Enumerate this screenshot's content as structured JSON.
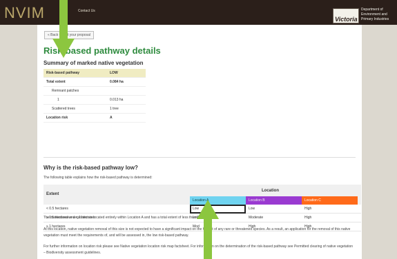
{
  "header": {
    "logo": "NVIM",
    "contact_label": "Contact Us",
    "vic_label": "Victoria",
    "department": [
      "Department of",
      "Environment and",
      "Primary Industries"
    ]
  },
  "back_button": "« Back to edit your proposal",
  "page_title": "Risk-based pathway details",
  "summary": {
    "title": "Summary of marked native vegetation",
    "rows": [
      {
        "key": "Risk-based pathway",
        "value": "LOW"
      },
      {
        "key": "Total extent",
        "value": "0.084 ha"
      },
      {
        "key": "Remnant patches",
        "value": ""
      },
      {
        "key": "1",
        "value": "0.013 ha"
      },
      {
        "key": "Scattered trees",
        "value": "1 tree"
      },
      {
        "key": "Location risk",
        "value": "A"
      }
    ]
  },
  "why": {
    "title": "Why is the risk-based pathway low?",
    "explain": "The following table explains how the risk-based pathway is determined:"
  },
  "location_table": {
    "extent_header": "Extent",
    "location_header": "Location",
    "columns": [
      "Location A",
      "Location B",
      "Location C"
    ],
    "rows": [
      {
        "extent": "< 0.5 hectares",
        "a": "Low",
        "b": "Low",
        "c": "High"
      },
      {
        "extent": "≥ 0.5 hectares and < 1 hectares",
        "a": "Low",
        "b": "Moderate",
        "c": "High"
      },
      {
        "extent": "≥ 1 hectares",
        "a": "Mod",
        "b": "High",
        "c": "High"
      }
    ]
  },
  "paragraphs": {
    "p1": "The marked native vegetation is located entirely within Location A and has a total extent of less than 0.5 hectares.",
    "p2": "At this location, native vegetation removal of this size is not expected to have a significant impact on the habitat of any rare or threatened species. As a result, an application for the removal of this native vegetation must meet the requirements of, and will be assessed in, the low risk-based pathway.",
    "p3": "For further information on location risk please see Native vegetation location risk map factsheet. For information on the determination of the risk-based pathway see Permitted clearing of native vegetation – Biodiversity assessment guidelines."
  },
  "colors": {
    "arrow": "#8cc63f",
    "title_green": "#2e8b3e",
    "location_a": "#6fd3f0",
    "location_b": "#9a3ad1",
    "location_c": "#ff6a1a"
  }
}
